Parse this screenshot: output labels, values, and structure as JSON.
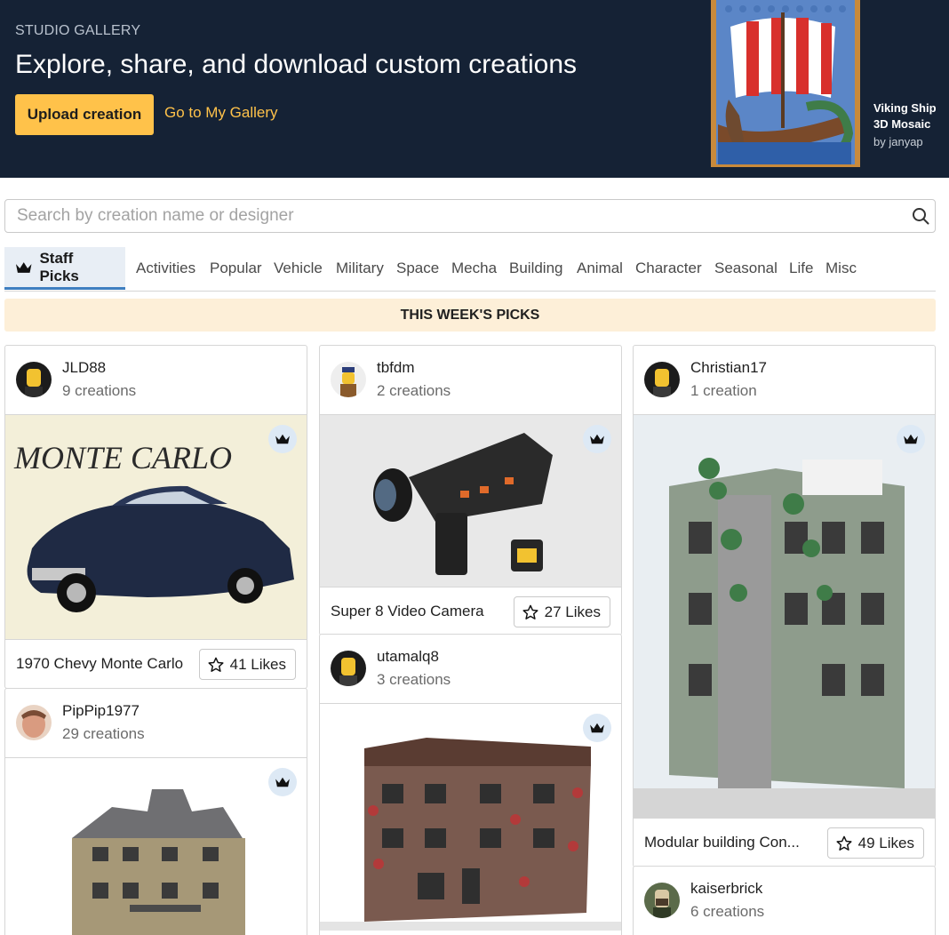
{
  "hero": {
    "eyebrow": "STUDIO GALLERY",
    "title": "Explore, share, and download custom creations",
    "upload_label": "Upload creation",
    "gallery_link": "Go to My Gallery",
    "featured": {
      "title": "Viking Ship 3D Mosaic",
      "author": "by janyap"
    }
  },
  "search": {
    "placeholder": "Search by creation name or designer",
    "value": ""
  },
  "tabs": [
    {
      "label": "Staff Picks",
      "active": true
    },
    {
      "label": "Activities"
    },
    {
      "label": "Popular"
    },
    {
      "label": "Vehicle"
    },
    {
      "label": "Military"
    },
    {
      "label": "Space"
    },
    {
      "label": "Mecha"
    },
    {
      "label": "Building"
    },
    {
      "label": "Animal"
    },
    {
      "label": "Character"
    },
    {
      "label": "Seasonal"
    },
    {
      "label": "Life"
    },
    {
      "label": "Misc"
    }
  ],
  "banner": "THIS WEEK'S PICKS",
  "cards": [
    {
      "designer": "JLD88",
      "count": "9 creations",
      "title": "1970 Chevy Monte Carlo",
      "likes": "41 Likes",
      "image_text": "MONTE CARLO"
    },
    {
      "designer": "tbfdm",
      "count": "2 creations",
      "title": "Super 8 Video Camera",
      "likes": "27 Likes"
    },
    {
      "designer": "Christian17",
      "count": "1 creation",
      "title": "Modular building Con...",
      "likes": "49 Likes"
    },
    {
      "designer": "PipPip1977",
      "count": "29 creations"
    },
    {
      "designer": "utamalq8",
      "count": "3 creations"
    },
    {
      "designer": "kaiserbrick",
      "count": "6 creations"
    }
  ],
  "colors": {
    "hero_bg": "#152235",
    "accent": "#ffc24a",
    "banner_bg": "#fdefd8",
    "active_tab_underline": "#3f7fc0"
  }
}
